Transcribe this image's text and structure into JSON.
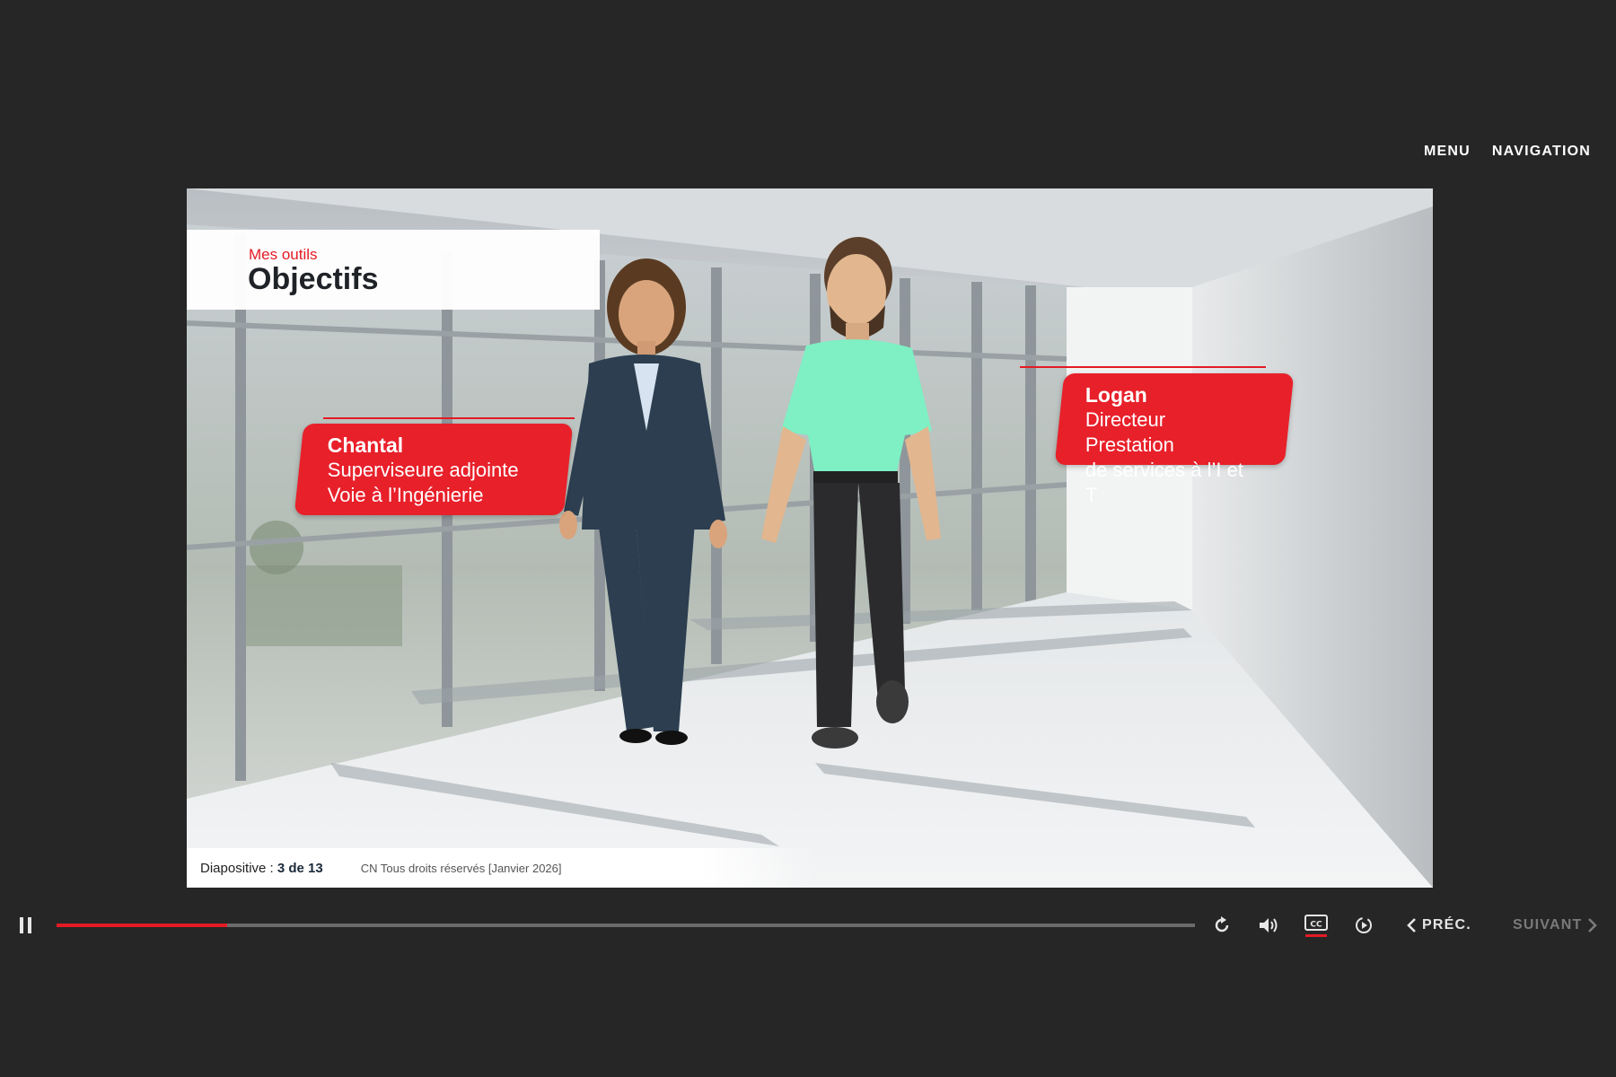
{
  "topnav": {
    "menu_label": "MENU",
    "navigation_label": "NAVIGATION"
  },
  "slide": {
    "kicker": "Mes outils",
    "title": "Objectifs",
    "characters": [
      {
        "name": "Chantal",
        "role_line1": "Superviseure adjointe",
        "role_line2": "Voie à l’Ingénierie"
      },
      {
        "name": "Logan",
        "role_line1": "Directeur Prestation",
        "role_line2": "de services à l’I et T"
      }
    ],
    "footer": {
      "counter_label": "Diapositive :",
      "counter_value": "3 de 13",
      "copyright": "CN Tous droits réservés [Janvier 2026]"
    }
  },
  "controls": {
    "progress": 0.15,
    "prev_label": "PRÉC.",
    "next_label": "SUIVANT",
    "icons": [
      "pause-icon",
      "replay-icon",
      "volume-icon",
      "closed-captions-icon",
      "playback-speed-icon",
      "chevron-left-icon",
      "chevron-right-icon"
    ]
  },
  "colors": {
    "accent": "#e31b23",
    "background": "#262626",
    "tag": "#e8202a",
    "shirt": "#7ef0c4",
    "suit": "#2c3e50"
  }
}
